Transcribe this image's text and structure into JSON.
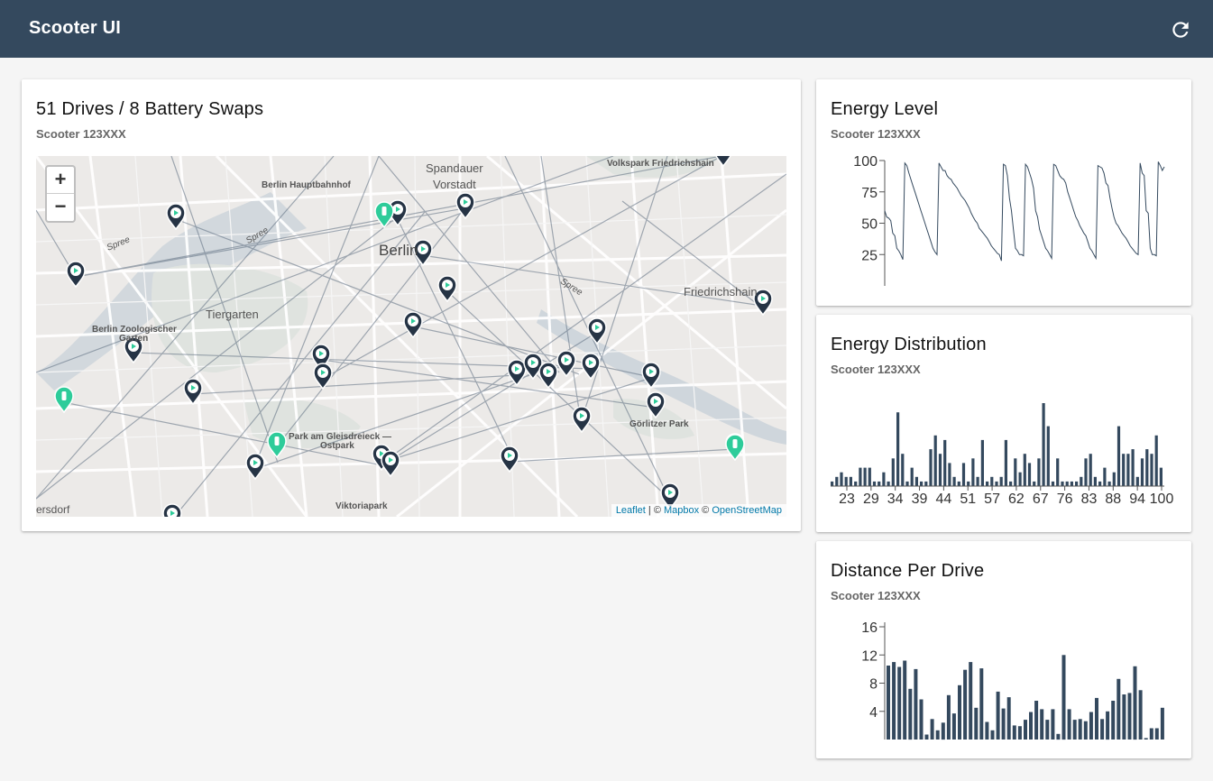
{
  "app": {
    "title": "Scooter UI",
    "refresh_icon": "refresh-icon"
  },
  "map_card": {
    "title": "51 Drives / 8 Battery Swaps",
    "subtitle": "Scooter 123XXX",
    "zoom_in": "+",
    "zoom_out": "−",
    "labels": {
      "volkspark": "Volkspark Friedrichshain",
      "spandauer": "Spandauer",
      "vorstadt": "Vorstadt",
      "hauptbahnhof": "Berlin Hauptbahnhof",
      "spree1": "Spree",
      "spree2": "Spree",
      "spree3": "Spree",
      "berlin": "Berlin",
      "friedrichshain": "Friedrichshain",
      "tiergarten": "Tiergarten",
      "zoo1": "Berlin Zoologischer",
      "zoo2": "Garten",
      "goerlitzer": "Görlitzer Park",
      "gleis1": "Park am Gleisdreieck —",
      "gleis2": "Ostpark",
      "viktoriapark": "Viktoriapark",
      "ersdorf": "ersdorf"
    },
    "attribution": {
      "leaflet": "Leaflet",
      "sep1": " | © ",
      "mapbox": "Mapbox",
      "sep2": " © ",
      "osm": "OpenStreetMap"
    },
    "colors": {
      "drive_marker": "#263445",
      "swap_marker": "#2ecc9a",
      "route": "#5d6d80"
    }
  },
  "energy_card": {
    "title": "Energy Level",
    "subtitle": "Scooter 123XXX",
    "chart_data": {
      "type": "line",
      "ylim": [
        0,
        100
      ],
      "yticks": [
        25,
        50,
        75,
        100
      ],
      "series": [
        {
          "values": [
            60,
            55,
            54,
            52,
            42,
            40,
            30,
            28,
            25,
            21,
            98,
            96,
            90,
            85,
            80,
            75,
            70,
            65,
            60,
            55,
            50,
            45,
            40,
            35,
            30,
            27,
            25,
            98,
            95,
            92,
            92,
            88,
            86,
            85,
            82,
            80,
            78,
            75,
            72,
            70,
            68,
            65,
            62,
            58,
            55,
            52,
            50,
            46,
            44,
            42,
            40,
            38,
            35,
            32,
            30,
            28,
            26,
            25,
            20,
            97,
            96,
            88,
            70,
            60,
            45,
            30,
            28,
            25,
            25,
            24,
            97,
            95,
            90,
            85,
            78,
            60,
            55,
            45,
            40,
            35,
            30,
            28,
            25,
            22,
            97,
            96,
            92,
            88,
            86,
            85,
            82,
            75,
            70,
            65,
            60,
            55,
            52,
            48,
            45,
            42,
            40,
            35,
            30,
            28,
            25,
            22,
            96,
            95,
            94,
            90,
            82,
            80,
            70,
            62,
            55,
            50,
            48,
            45,
            42,
            40,
            38,
            35,
            32,
            30,
            28,
            26,
            25,
            98,
            90,
            88,
            60,
            58,
            30,
            25,
            25,
            24,
            99,
            96,
            92,
            95
          ]
        }
      ]
    }
  },
  "dist_card": {
    "title": "Energy Distribution",
    "subtitle": "Scooter 123XXX",
    "chart_data": {
      "type": "bar",
      "xticks": [
        "23",
        "29",
        "34",
        "39",
        "44",
        "51",
        "57",
        "62",
        "67",
        "76",
        "83",
        "88",
        "94",
        "100"
      ],
      "series": [
        {
          "values": [
            1,
            2,
            3,
            2,
            2,
            1,
            4,
            4,
            4,
            1,
            1,
            3,
            1,
            6,
            16,
            7,
            1,
            4,
            2,
            1,
            1,
            8,
            11,
            7,
            10,
            5,
            2,
            1,
            5,
            1,
            6,
            2,
            10,
            1,
            2,
            1,
            2,
            10,
            1,
            6,
            3,
            7,
            5,
            1,
            6,
            18,
            13,
            1,
            6,
            1,
            1,
            1,
            1,
            2,
            6,
            7,
            2,
            1,
            4,
            1,
            3,
            13,
            7,
            7,
            8,
            2,
            6,
            8,
            7,
            11,
            4
          ]
        }
      ]
    }
  },
  "drive_card": {
    "title": "Distance Per Drive",
    "subtitle": "Scooter 123XXX",
    "chart_data": {
      "type": "bar",
      "ylim": [
        0,
        16
      ],
      "yticks": [
        4,
        8,
        12,
        16
      ],
      "series": [
        {
          "values": [
            10.5,
            11,
            10.3,
            11.2,
            7.2,
            10,
            5.7,
            0.7,
            2.9,
            1.3,
            2.4,
            6.3,
            3.7,
            7.7,
            9.9,
            11,
            4.5,
            10.1,
            2.5,
            1.3,
            6.8,
            4.4,
            6,
            2,
            1.9,
            2.8,
            3.9,
            5.5,
            4.3,
            2.8,
            4.3,
            0.8,
            12,
            4.3,
            2.8,
            2.9,
            2.6,
            3.9,
            5.9,
            2.9,
            4,
            5.5,
            8.6,
            6.4,
            6.6,
            10.4,
            7,
            0.2,
            1.6,
            1.6,
            4.5
          ]
        }
      ]
    }
  }
}
